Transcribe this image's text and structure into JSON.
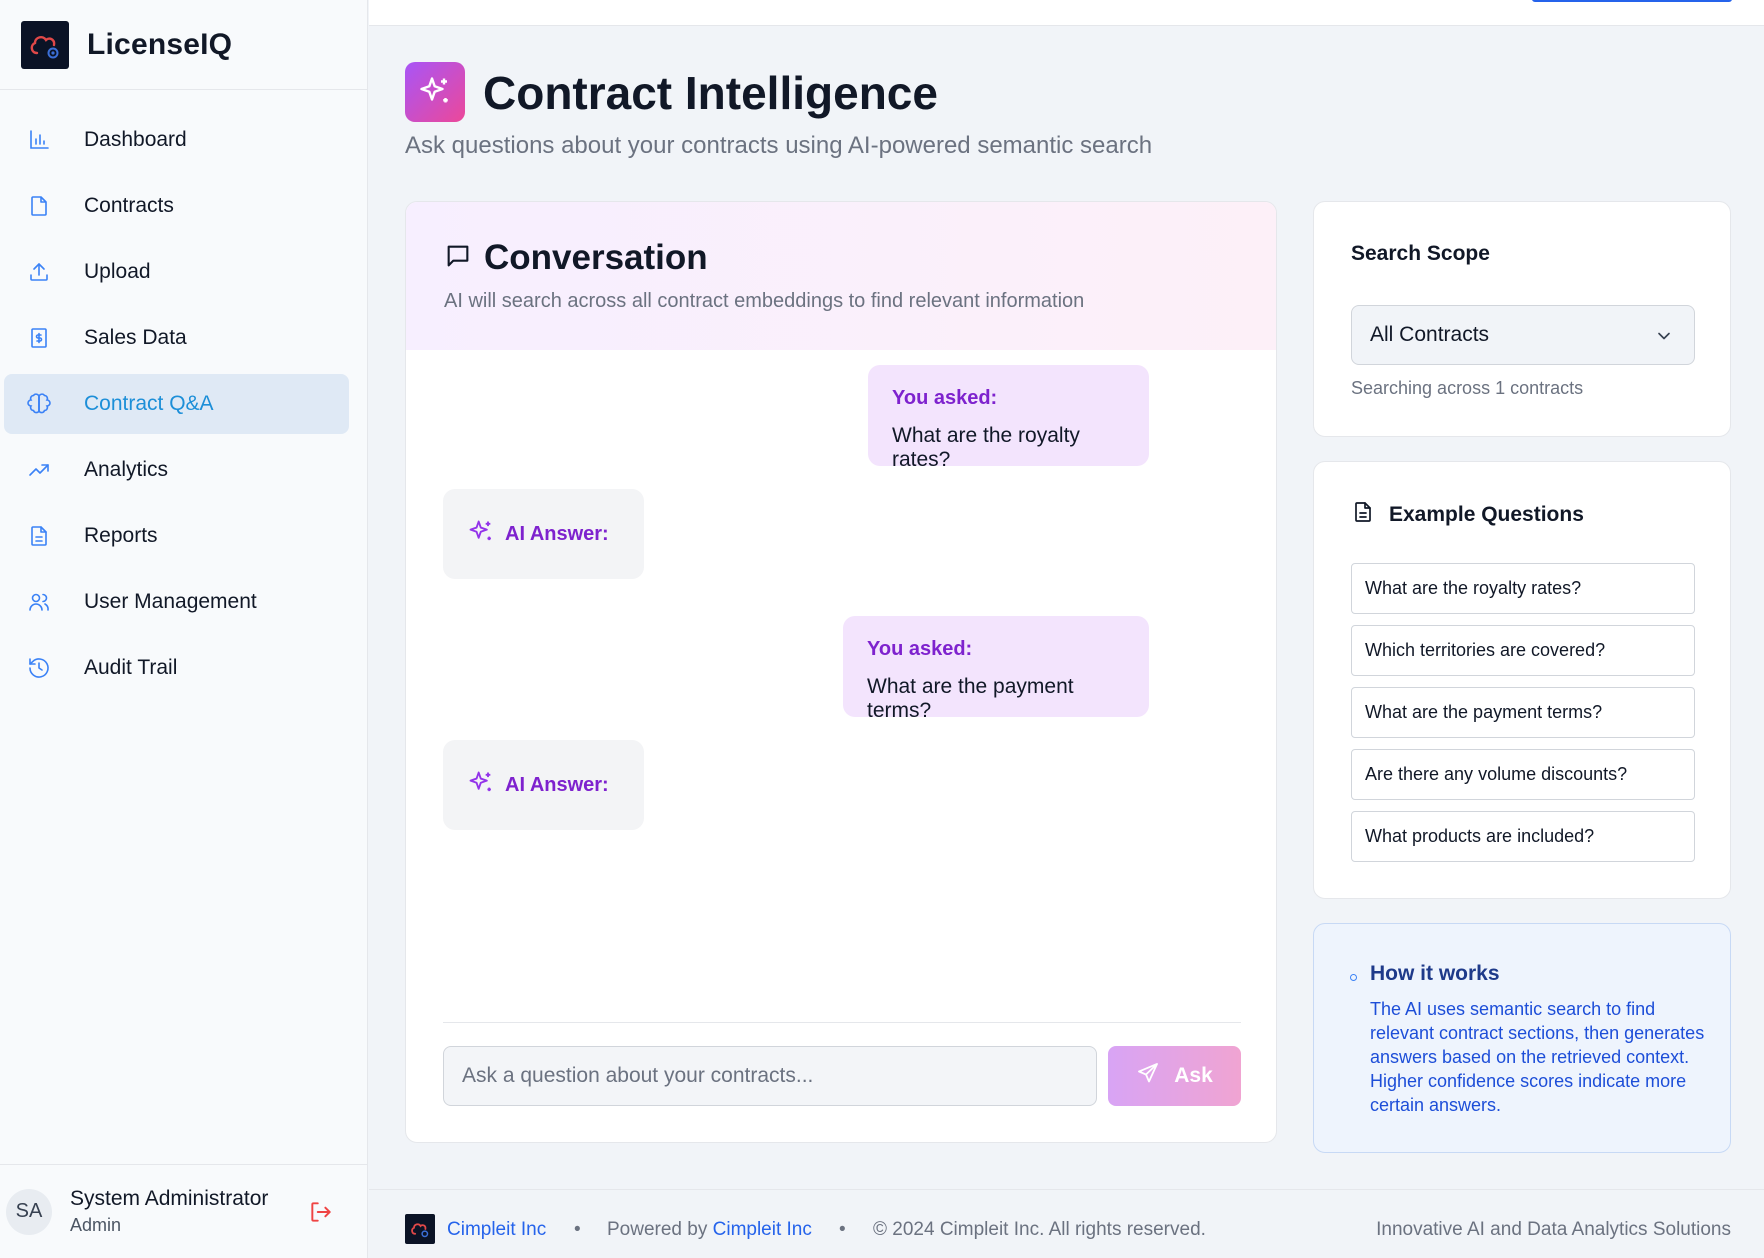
{
  "app": {
    "name": "LicenseIQ"
  },
  "sidebar": {
    "items": [
      {
        "label": "Dashboard",
        "icon": "bar-chart-icon"
      },
      {
        "label": "Contracts",
        "icon": "file-icon"
      },
      {
        "label": "Upload",
        "icon": "upload-icon"
      },
      {
        "label": "Sales Data",
        "icon": "dollar-file-icon"
      },
      {
        "label": "Contract Q&A",
        "icon": "brain-icon",
        "active": true
      },
      {
        "label": "Analytics",
        "icon": "trending-up-icon"
      },
      {
        "label": "Reports",
        "icon": "file-text-icon"
      },
      {
        "label": "User Management",
        "icon": "users-icon"
      },
      {
        "label": "Audit Trail",
        "icon": "history-icon"
      }
    ],
    "user": {
      "initials": "SA",
      "name": "System Administrator",
      "role": "Admin"
    }
  },
  "page": {
    "title": "Contract Intelligence",
    "subtitle": "Ask questions about your contracts using AI-powered semantic search"
  },
  "conversation": {
    "title": "Conversation",
    "description": "AI will search across all contract embeddings to find relevant information",
    "asked_label": "You asked:",
    "answer_label": "AI Answer:",
    "messages": [
      {
        "role": "user",
        "text": "What are the royalty rates?"
      },
      {
        "role": "ai"
      },
      {
        "role": "user",
        "text": "What are the payment terms?"
      },
      {
        "role": "ai"
      }
    ],
    "input_placeholder": "Ask a question about your contracts...",
    "ask_label": "Ask"
  },
  "scope": {
    "title": "Search Scope",
    "selected": "All Contracts",
    "note": "Searching across 1 contracts"
  },
  "examples": {
    "title": "Example Questions",
    "items": [
      "What are the royalty rates?",
      "Which territories are covered?",
      "What are the payment terms?",
      "Are there any volume discounts?",
      "What products are included?"
    ]
  },
  "how_it_works": {
    "title": "How it works",
    "text": "The AI uses semantic search to find relevant contract sections, then generates answers based on the retrieved context. Higher confidence scores indicate more certain answers."
  },
  "footer": {
    "company": "Cimpleit Inc",
    "separator": "•",
    "powered_prefix": "Powered by",
    "powered_link": "Cimpleit Inc",
    "copyright": "© 2024 Cimpleit Inc. All rights reserved.",
    "tagline": "Innovative AI and Data Analytics Solutions"
  },
  "colors": {
    "accent_blue": "#1d8fd8",
    "accent_purple": "#7e22ce",
    "gradient_start": "#a855f7",
    "gradient_end": "#ec4899",
    "logout_red": "#ef4444"
  }
}
